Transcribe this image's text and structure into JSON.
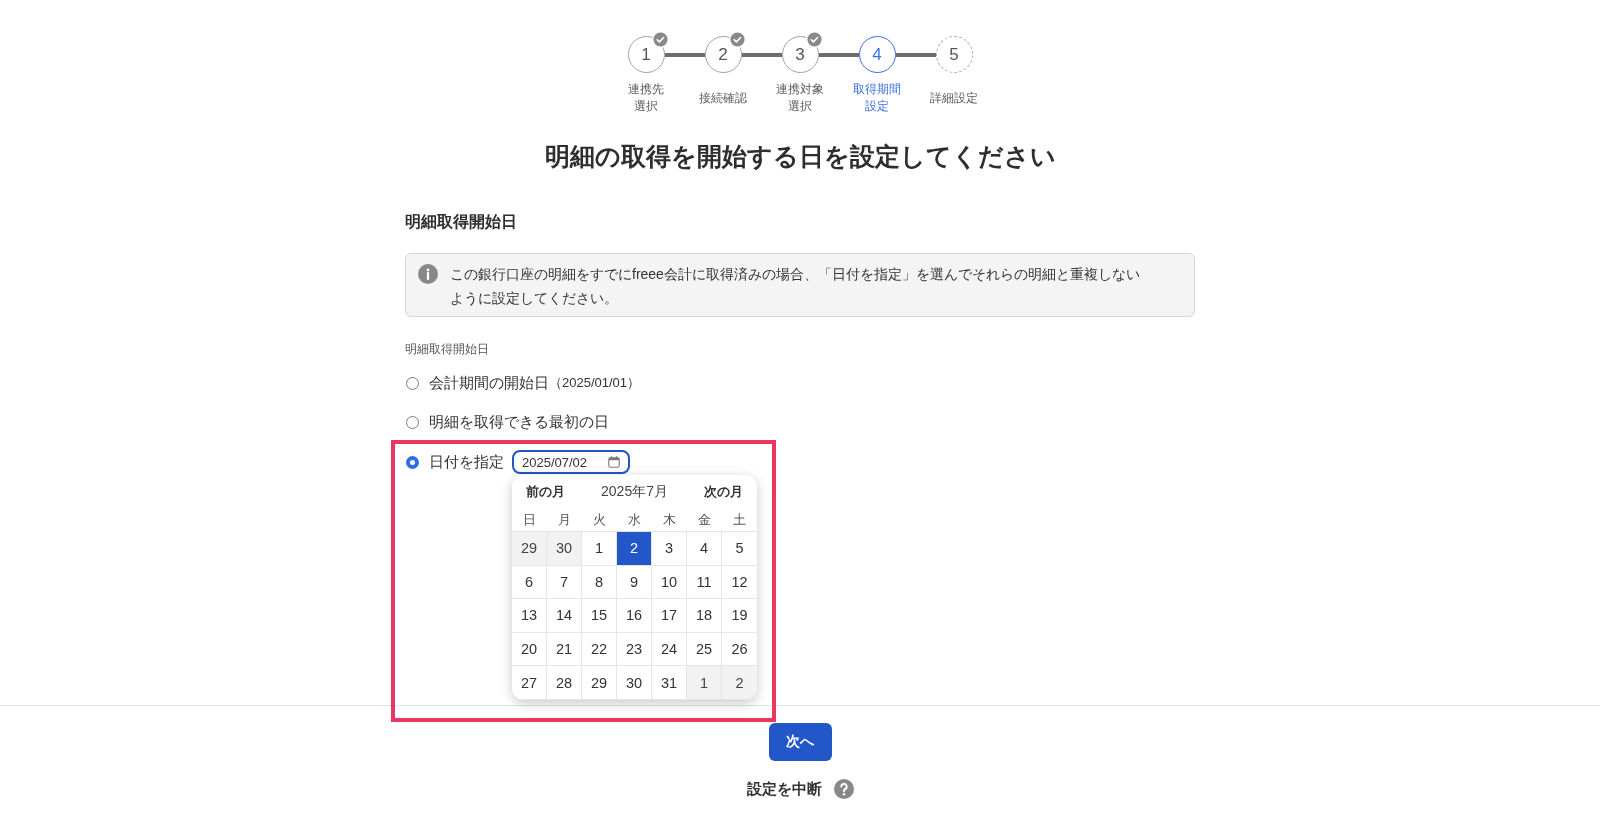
{
  "stepper": {
    "steps": [
      {
        "number": "1",
        "label_lines": [
          "連携先",
          "選択"
        ],
        "completed": true,
        "current": false
      },
      {
        "number": "2",
        "label_lines": [
          "接続確認"
        ],
        "completed": true,
        "current": false
      },
      {
        "number": "3",
        "label_lines": [
          "連携対象",
          "選択"
        ],
        "completed": true,
        "current": false
      },
      {
        "number": "4",
        "label_lines": [
          "取得期間",
          "設定"
        ],
        "completed": false,
        "current": true
      },
      {
        "number": "5",
        "label_lines": [
          "詳細設定"
        ],
        "completed": false,
        "current": false
      }
    ]
  },
  "page_title": "明細の取得を開始する日を設定してください",
  "section": {
    "heading": "明細取得開始日",
    "notice": "この銀行口座の明細をすでにfreee会計に取得済みの場合、「日付を指定」を選んでそれらの明細と重複しないように設定してください。",
    "field_label": "明細取得開始日",
    "options": [
      {
        "kind": "plain",
        "label": "会計期間の開始日",
        "note": "（2025/01/01）",
        "selected": false
      },
      {
        "kind": "plain",
        "label": "明細を取得できる最初の日",
        "selected": false
      },
      {
        "kind": "date",
        "label": "日付を指定",
        "date_value": "2025/07/02",
        "selected": true
      }
    ],
    "date_picker": {
      "prev_label": "前の月",
      "month_label": "2025年7月",
      "next_label": "次の月",
      "weekdays": [
        "日",
        "月",
        "火",
        "水",
        "木",
        "金",
        "土"
      ],
      "weeks": [
        [
          {
            "day": "29",
            "outside_month": true,
            "selected": false
          },
          {
            "day": "30",
            "outside_month": true,
            "selected": false
          },
          {
            "day": "1",
            "outside_month": false,
            "selected": false
          },
          {
            "day": "2",
            "outside_month": false,
            "selected": true
          },
          {
            "day": "3",
            "outside_month": false,
            "selected": false
          },
          {
            "day": "4",
            "outside_month": false,
            "selected": false
          },
          {
            "day": "5",
            "outside_month": false,
            "selected": false
          }
        ],
        [
          {
            "day": "6",
            "outside_month": false,
            "selected": false
          },
          {
            "day": "7",
            "outside_month": false,
            "selected": false
          },
          {
            "day": "8",
            "outside_month": false,
            "selected": false
          },
          {
            "day": "9",
            "outside_month": false,
            "selected": false
          },
          {
            "day": "10",
            "outside_month": false,
            "selected": false
          },
          {
            "day": "11",
            "outside_month": false,
            "selected": false
          },
          {
            "day": "12",
            "outside_month": false,
            "selected": false
          }
        ],
        [
          {
            "day": "13",
            "outside_month": false,
            "selected": false
          },
          {
            "day": "14",
            "outside_month": false,
            "selected": false
          },
          {
            "day": "15",
            "outside_month": false,
            "selected": false
          },
          {
            "day": "16",
            "outside_month": false,
            "selected": false
          },
          {
            "day": "17",
            "outside_month": false,
            "selected": false
          },
          {
            "day": "18",
            "outside_month": false,
            "selected": false
          },
          {
            "day": "19",
            "outside_month": false,
            "selected": false
          }
        ],
        [
          {
            "day": "20",
            "outside_month": false,
            "selected": false
          },
          {
            "day": "21",
            "outside_month": false,
            "selected": false
          },
          {
            "day": "22",
            "outside_month": false,
            "selected": false
          },
          {
            "day": "23",
            "outside_month": false,
            "selected": false
          },
          {
            "day": "24",
            "outside_month": false,
            "selected": false
          },
          {
            "day": "25",
            "outside_month": false,
            "selected": false
          },
          {
            "day": "26",
            "outside_month": false,
            "selected": false
          }
        ],
        [
          {
            "day": "27",
            "outside_month": false,
            "selected": false
          },
          {
            "day": "28",
            "outside_month": false,
            "selected": false
          },
          {
            "day": "29",
            "outside_month": false,
            "selected": false
          },
          {
            "day": "30",
            "outside_month": false,
            "selected": false
          },
          {
            "day": "31",
            "outside_month": false,
            "selected": false
          },
          {
            "day": "1",
            "outside_month": true,
            "selected": false
          },
          {
            "day": "2",
            "outside_month": true,
            "selected": false
          }
        ]
      ]
    }
  },
  "next_button": "次へ",
  "cancel_link": "設定を中断"
}
